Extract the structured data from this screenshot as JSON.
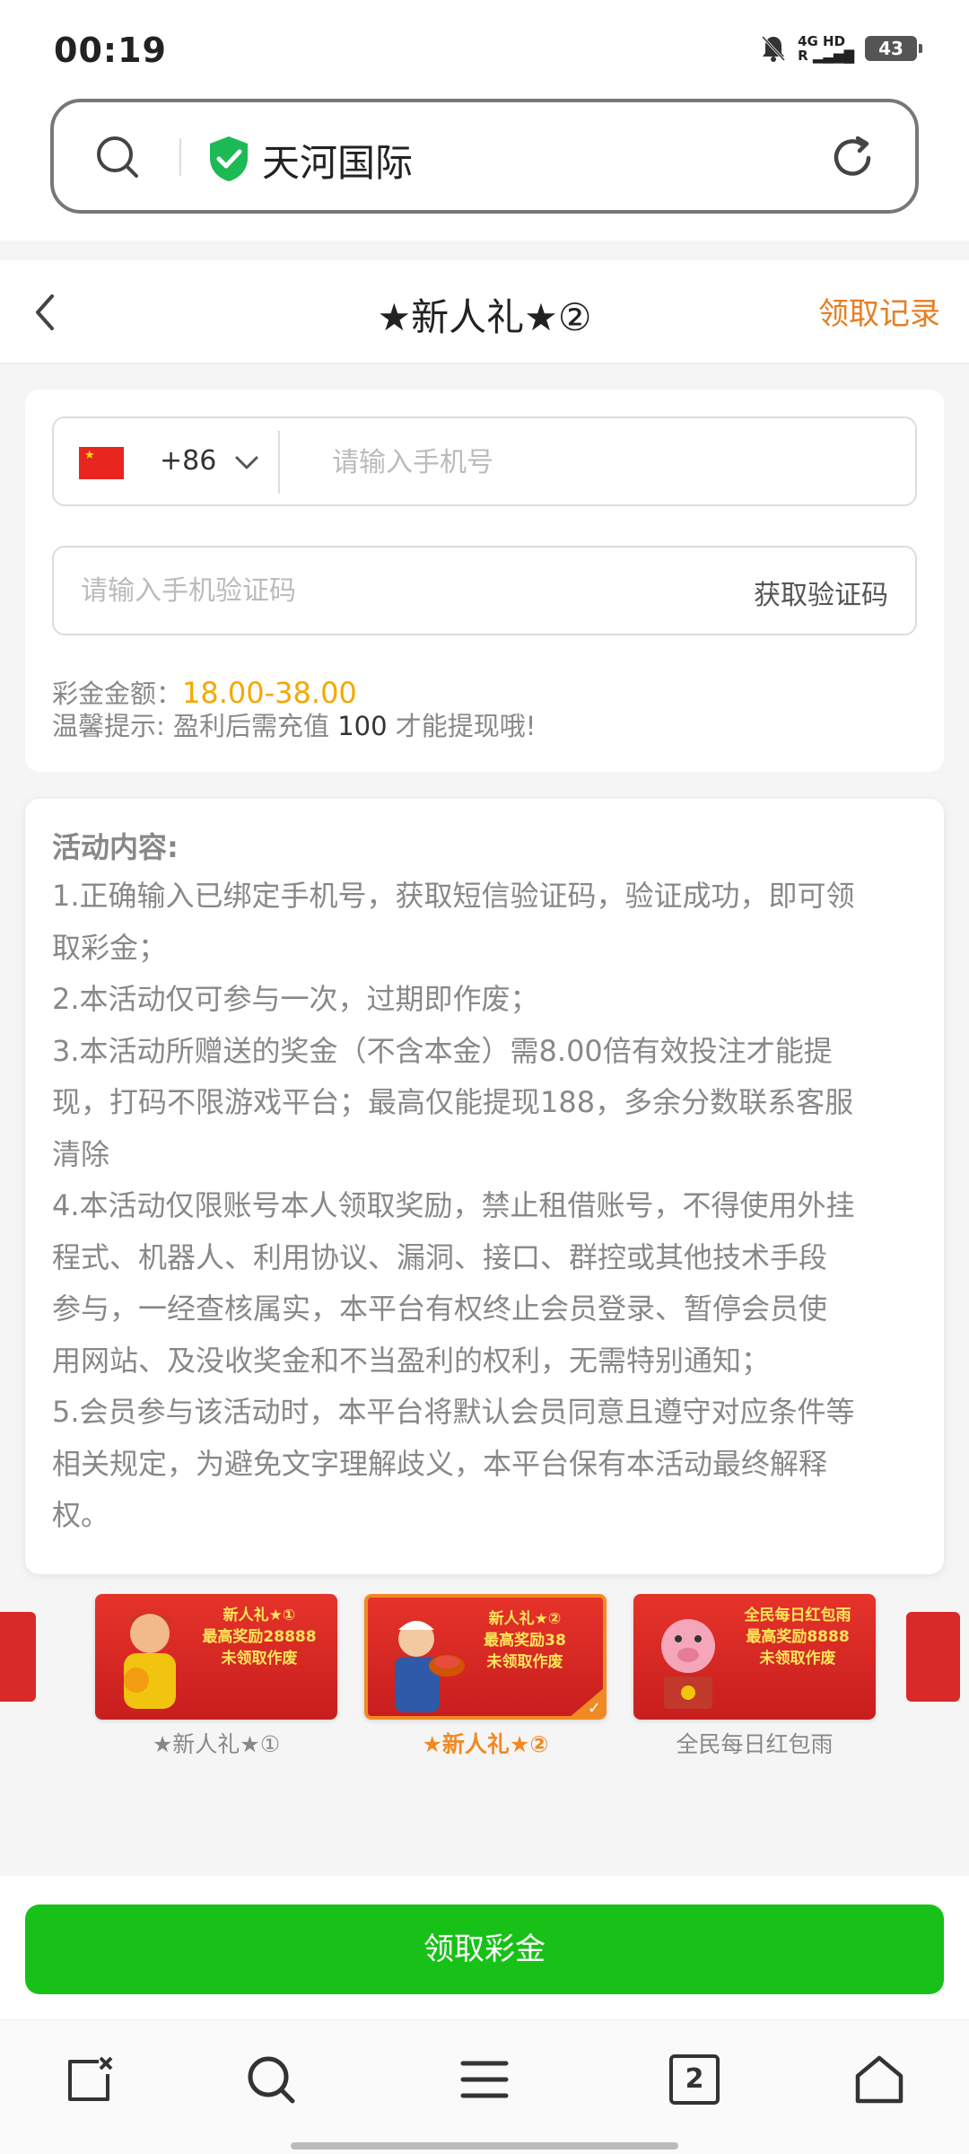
{
  "status_bar": {
    "time": "00:19",
    "network": "4G HD",
    "network2": "R",
    "battery": "43"
  },
  "url_bar": {
    "site_name": "天河国际",
    "icons": [
      "search-icon",
      "shield-check-icon",
      "reload-icon"
    ]
  },
  "header": {
    "title": "★新人礼★②",
    "records": "领取记录"
  },
  "form": {
    "country_code": "+86",
    "phone_placeholder": "请输入手机号",
    "code_placeholder": "请输入手机验证码",
    "get_code": "获取验证码",
    "amount_label": "彩金金额：",
    "amount_value": "18.00-38.00",
    "tip_prefix": "温馨提示: 盈利后需充值",
    "tip_num": "100",
    "tip_suffix": "才能提现哦!"
  },
  "activity": {
    "title": "活动内容:",
    "lines": [
      "1.正确输入已绑定手机号，获取短信验证码，验证成功，即可领",
      "取彩金；",
      "2.本活动仅可参与一次，过期即作废；",
      "3.本活动所赠送的奖金（不含本金）需8.00倍有效投注才能提",
      "现，打码不限游戏平台；最高仅能提现188，多余分数联系客服",
      "清除",
      "4.本活动仅限账号本人领取奖励，禁止租借账号，不得使用外挂",
      "程式、机器人、利用协议、漏洞、接口、群控或其他技术手段",
      "参与，一经查核属实，本平台有权终止会员登录、暂停会员使",
      "用网站、及没收奖金和不当盈利的权利，无需特别通知；",
      "5.会员参与该活动时，本平台将默认会员同意且遵守对应条件等",
      "相关规定，为避免文字理解歧义，本平台保有本活动最终解释",
      "权。"
    ]
  },
  "promos": [
    {
      "label": "★新人礼★①",
      "line1": "新人礼★①",
      "line2": "最高奖励28888",
      "line3": "未领取作废",
      "active": false
    },
    {
      "label": "★新人礼★②",
      "line1": "新人礼★②",
      "line2": "最高奖励38",
      "line3": "未领取作废",
      "active": true
    },
    {
      "label": "全民每日红包雨",
      "line1": "全民每日红包雨",
      "line2": "最高奖励8888",
      "line3": "未领取作废",
      "active": false
    }
  ],
  "claim_button": "领取彩金",
  "nav": {
    "tab_count": "2",
    "icons": [
      "edit-icon",
      "search-icon",
      "menu-icon",
      "tabs-icon",
      "home-icon"
    ]
  },
  "colors": {
    "accent_orange": "#e67e22",
    "amount_yellow": "#f5a800",
    "claim_green": "#18c118"
  }
}
